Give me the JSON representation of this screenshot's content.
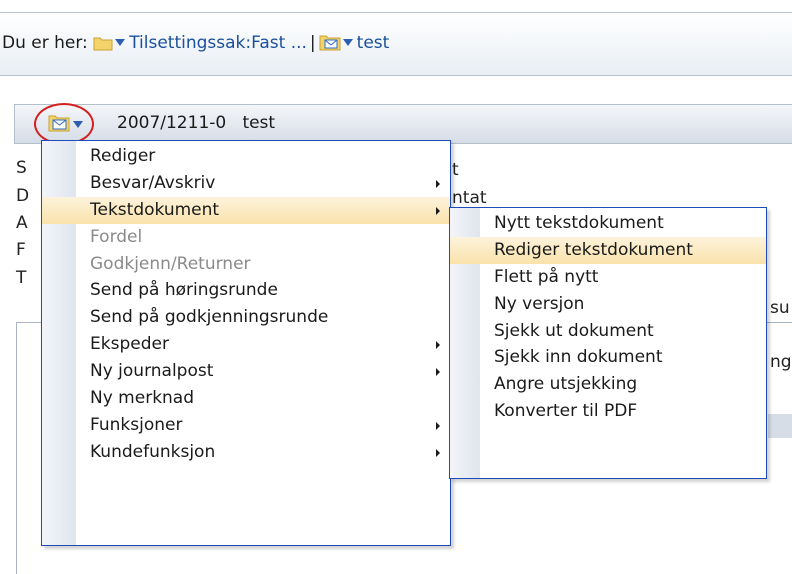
{
  "breadcrumb": {
    "prefix": "Du er her:",
    "items": [
      "Tilsettingssak:Fast ...",
      "test"
    ],
    "separator": "|"
  },
  "document": {
    "number": "2007/1211-0",
    "title": "test"
  },
  "background_fragments": {
    "left_letters": [
      "S",
      "D",
      "A",
      "F",
      "T"
    ],
    "right_texts": [
      "t",
      "ntat",
      "su",
      "ng"
    ]
  },
  "context_menu": {
    "items": [
      {
        "label": "Rediger",
        "has_submenu": false,
        "disabled": false
      },
      {
        "label": "Besvar/Avskriv",
        "has_submenu": true,
        "disabled": false
      },
      {
        "label": "Tekstdokument",
        "has_submenu": true,
        "disabled": false,
        "highlighted": true
      },
      {
        "label": "Fordel",
        "has_submenu": false,
        "disabled": true
      },
      {
        "label": "Godkjenn/Returner",
        "has_submenu": false,
        "disabled": true
      },
      {
        "label": "Send på høringsrunde",
        "has_submenu": false,
        "disabled": false
      },
      {
        "label": "Send på godkjenningsrunde",
        "has_submenu": false,
        "disabled": false
      },
      {
        "label": "Ekspeder",
        "has_submenu": true,
        "disabled": false
      },
      {
        "label": "Ny journalpost",
        "has_submenu": true,
        "disabled": false
      },
      {
        "label": "Ny merknad",
        "has_submenu": false,
        "disabled": false
      },
      {
        "label": "Funksjoner",
        "has_submenu": true,
        "disabled": false
      },
      {
        "label": "Kundefunksjon",
        "has_submenu": true,
        "disabled": false
      }
    ]
  },
  "submenu": {
    "items": [
      {
        "label": "Nytt tekstdokument"
      },
      {
        "label": "Rediger tekstdokument",
        "highlighted": true
      },
      {
        "label": "Flett på nytt"
      },
      {
        "label": "Ny versjon"
      },
      {
        "label": "Sjekk ut dokument"
      },
      {
        "label": "Sjekk inn dokument"
      },
      {
        "label": "Angre utsjekking"
      },
      {
        "label": "Konverter til PDF"
      }
    ]
  },
  "colors": {
    "link": "#1a4f9c",
    "highlight": "#f9e2aa",
    "menu_border": "#1d4cb8",
    "annotation": "#d42020"
  }
}
